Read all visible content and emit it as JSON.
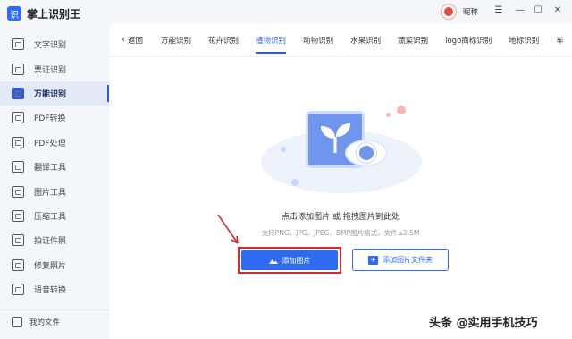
{
  "app": {
    "title": "掌上识别王",
    "logo_char": "识"
  },
  "sidebar": {
    "items": [
      {
        "label": "文字识别",
        "icon": "text-scan-icon",
        "active": false
      },
      {
        "label": "票证识别",
        "icon": "ticket-icon",
        "active": false
      },
      {
        "label": "万能识别",
        "icon": "camera-icon",
        "active": true
      },
      {
        "label": "PDF转换",
        "icon": "pdf-convert-icon",
        "active": false
      },
      {
        "label": "PDF处理",
        "icon": "pdf-process-icon",
        "active": false
      },
      {
        "label": "翻译工具",
        "icon": "translate-icon",
        "active": false
      },
      {
        "label": "图片工具",
        "icon": "image-tool-icon",
        "active": false
      },
      {
        "label": "压缩工具",
        "icon": "compress-icon",
        "active": false
      },
      {
        "label": "拍证件照",
        "icon": "id-photo-icon",
        "active": false
      },
      {
        "label": "修复照片",
        "icon": "photo-repair-icon",
        "active": false
      },
      {
        "label": "语音转换",
        "icon": "voice-convert-icon",
        "active": false
      }
    ],
    "my_files": "我的文件"
  },
  "titlebar": {
    "nickname": "昵称",
    "menu_glyph": "☰",
    "minimize_glyph": "—",
    "maximize_glyph": "☐",
    "close_glyph": "✕"
  },
  "tabs": {
    "back_label": "返回",
    "items": [
      {
        "label": "万能识别",
        "active": false
      },
      {
        "label": "花卉识别",
        "active": false
      },
      {
        "label": "植物识别",
        "active": true
      },
      {
        "label": "动物识别",
        "active": false
      },
      {
        "label": "水果识别",
        "active": false
      },
      {
        "label": "蔬菜识别",
        "active": false
      },
      {
        "label": "logo商标识别",
        "active": false
      },
      {
        "label": "地标识别",
        "active": false
      },
      {
        "label": "车",
        "active": false
      }
    ]
  },
  "upload": {
    "hint": "点击添加图片 或 拖拽图片到此处",
    "formats": "支持PNG、JPG、JPEG、BMP图片格式，文件≤2.5M",
    "add_image_label": "添加图片",
    "add_folder_label": "添加图片文件夹"
  },
  "watermark": "头条 @实用手机技巧",
  "colors": {
    "accent": "#2f6bf0",
    "highlight_border": "#d9282f",
    "arrow": "#d9282f"
  }
}
